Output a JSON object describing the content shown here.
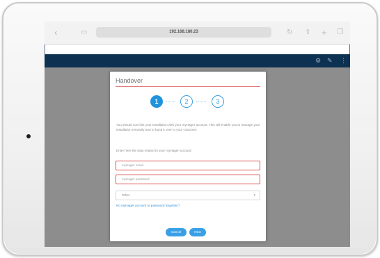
{
  "browser": {
    "url": "192.168.180.23",
    "back_icon": "chevron-left-icon",
    "bookmarks_icon": "book-icon",
    "reload_icon": "reload-icon",
    "share_icon": "share-icon",
    "new_tab_icon": "plus-icon",
    "tabs_icon": "tabs-icon"
  },
  "appbar": {
    "icons": [
      "settings-icon",
      "pencil-icon",
      "menu-icon"
    ]
  },
  "dialog": {
    "title": "Handover",
    "steps": [
      "1",
      "2",
      "3"
    ],
    "active_step": 1,
    "description": "You should now link your installation with your myHager account. This will enable you to manage your installation remotely and to hand it over to your customer.",
    "prompt": "Enter here the data related to your myHager account:",
    "email_placeholder": "myHager email",
    "password_placeholder": "myHager password",
    "select_value": "Other",
    "link_text": "No myHager account or password forgotten?",
    "cancel_label": "Cancel",
    "next_label": "Next"
  },
  "colors": {
    "accent": "#1f93dc",
    "appbar": "#0d3150",
    "error_border": "#d9534f"
  }
}
